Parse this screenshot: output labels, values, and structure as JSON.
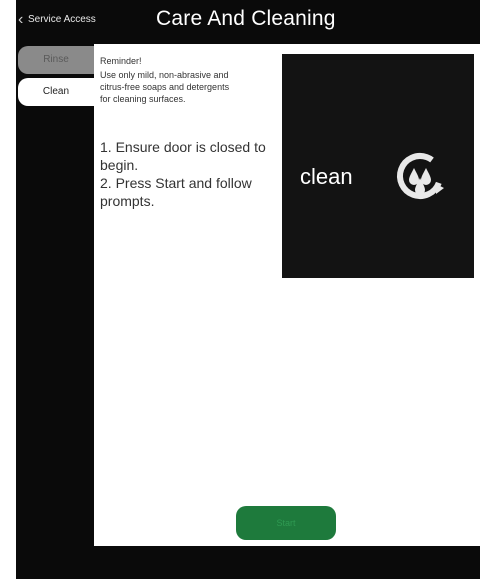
{
  "header": {
    "back_label": "Service Access",
    "title": "Care And Cleaning"
  },
  "sidebar": {
    "tabs": [
      {
        "label": "Rinse",
        "selected": false
      },
      {
        "label": "Clean",
        "selected": true
      }
    ]
  },
  "main": {
    "reminder_title": "Reminder!",
    "reminder_lines": [
      "Use only mild, non-abrasive and",
      "citrus-free soaps and detergents",
      "for cleaning surfaces."
    ],
    "steps": [
      "1. Ensure door is closed to begin.",
      "2. Press Start and follow prompts."
    ],
    "media": {
      "word": "clean",
      "icon": "clean-cycle-icon"
    },
    "start_button_label": "Start"
  },
  "colors": {
    "background": "#0a0a0a",
    "content": "#ffffff",
    "accent_green": "#1e7a3c",
    "inactive_tab": "#8a8a8a"
  }
}
